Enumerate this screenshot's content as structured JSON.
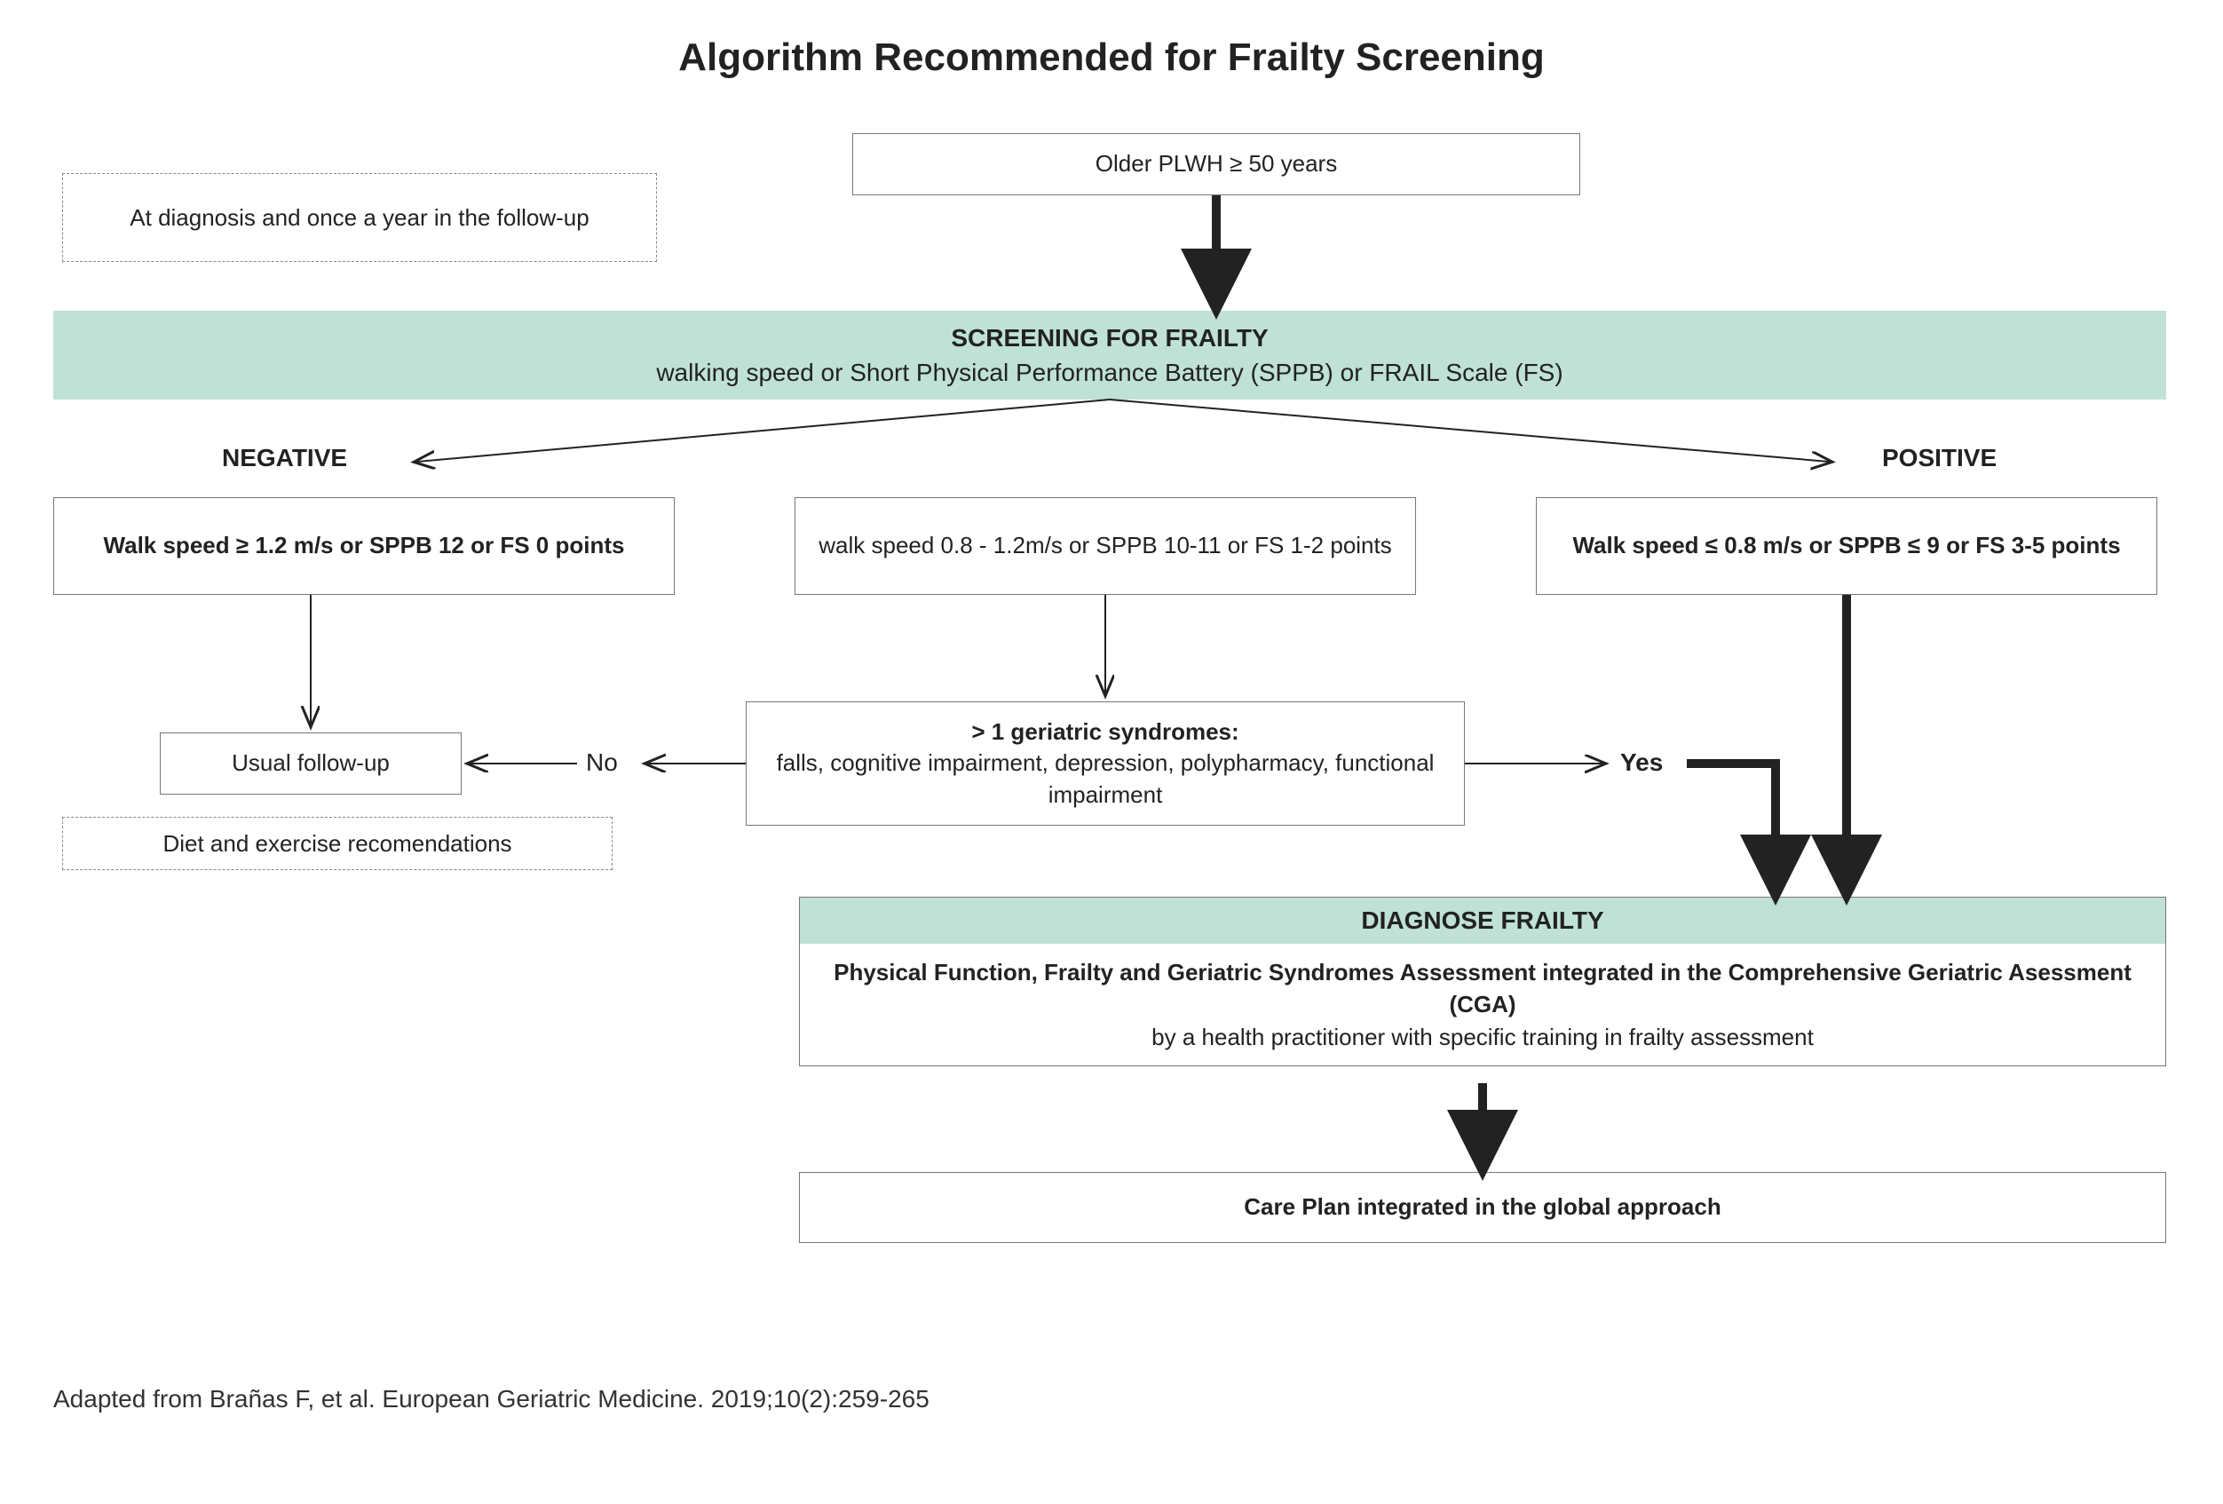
{
  "title": "Algorithm Recommended for Frailty Screening",
  "start_box": "Older PLWH ≥ 50 years",
  "timing_note": "At diagnosis and once a year in the follow-up",
  "screening": {
    "heading": "SCREENING FOR FRAILTY",
    "sub": "walking speed  or Short Physical Performance Battery (SPPB) or FRAIL Scale (FS)"
  },
  "branch_labels": {
    "negative": "NEGATIVE",
    "positive": "POSITIVE"
  },
  "negative_box": "Walk speed ≥ 1.2 m/s or SPPB 12 or FS 0 points",
  "intermediate_box": "walk speed 0.8 - 1.2m/s or SPPB 10-11 or FS 1-2 points",
  "positive_box": "Walk speed ≤ 0.8 m/s or SPPB ≤ 9 or FS 3-5 points",
  "geriatric_box": {
    "head": "> 1 geriatric syndromes:",
    "body": "falls, cognitive impairment, depression, polypharmacy, functional impairment"
  },
  "decision": {
    "no": "No",
    "yes": "Yes"
  },
  "followup_box": "Usual follow-up",
  "diet_note": "Diet and exercise recomendations",
  "diagnose": {
    "heading": "DIAGNOSE FRAILTY",
    "body_bold": "Physical Function, Frailty and Geriatric Syndromes Assessment integrated in the Comprehensive Geriatric Asessment (CGA)",
    "body_plain": "by a health practitioner with specific training in frailty assessment"
  },
  "careplan_box": "Care Plan integrated in the global approach",
  "citation": "Adapted from Brañas F, et al. European Geriatric Medicine. 2019;10(2):259-265"
}
